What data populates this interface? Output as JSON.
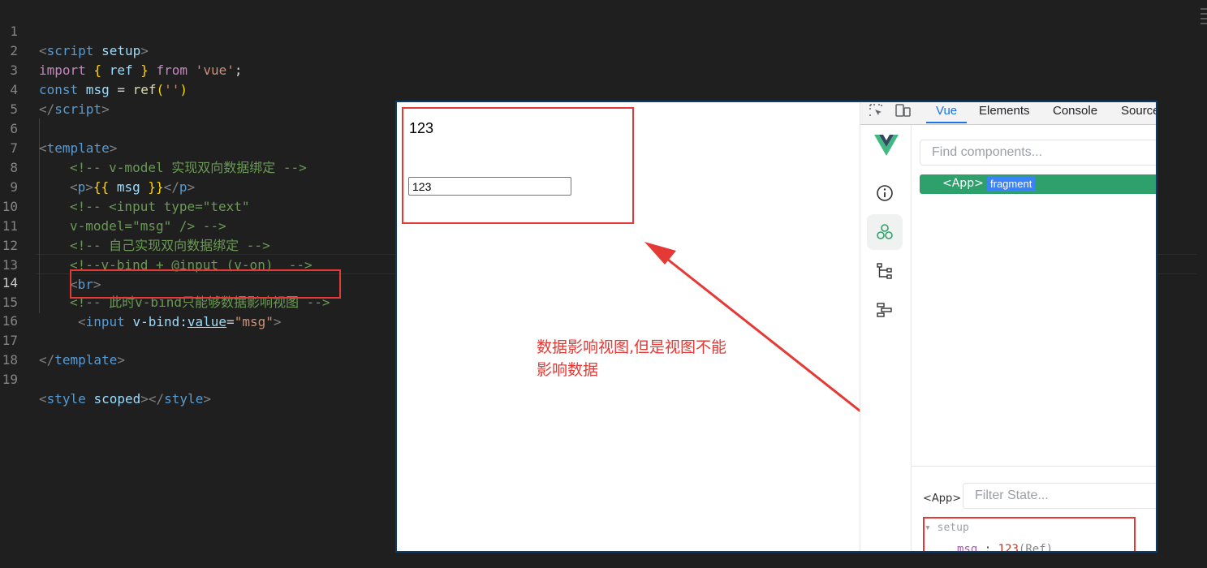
{
  "editor": {
    "lines": [
      {
        "n": "1"
      },
      {
        "n": "2"
      },
      {
        "n": "3"
      },
      {
        "n": "4"
      },
      {
        "n": "5"
      },
      {
        "n": "6"
      },
      {
        "n": "7"
      },
      {
        "n": "8"
      },
      {
        "n": "9"
      },
      {
        "n": "10"
      },
      {
        "n": "11"
      },
      {
        "n": "12"
      },
      {
        "n": "13"
      },
      {
        "n": "14"
      },
      {
        "n": "15"
      },
      {
        "n": "16"
      },
      {
        "n": "17"
      },
      {
        "n": "18"
      },
      {
        "n": "19"
      }
    ],
    "l1": {
      "open": "<",
      "tag": "script",
      "attr": " setup",
      "close": ">"
    },
    "l2": {
      "kw": "import",
      "b1": " { ",
      "var": "ref",
      "b2": " } ",
      "from": "from",
      "str": " 'vue'",
      "semi": ";"
    },
    "l3": {
      "kw": "const",
      "var": " msg",
      "eq": " = ",
      "fn": "ref",
      "p1": "(",
      "str": "''",
      "p2": ")"
    },
    "l4": {
      "open": "</",
      "tag": "script",
      "close": ">"
    },
    "l6": {
      "open": "<",
      "tag": "template",
      "close": ">"
    },
    "l7": {
      "comment": "<!-- v-model 实现双向数据绑定 -->"
    },
    "l8": {
      "open": "<",
      "tag": "p",
      "close": ">",
      "mus1": "{{",
      "var": " msg ",
      "mus2": "}}",
      "open2": "</",
      "tag2": "p",
      "close2": ">"
    },
    "l9": {
      "comment": "<!-- <input type=\"text\""
    },
    "l10": {
      "comment": "v-model=\"msg\" /> -->"
    },
    "l11": {
      "comment": "<!-- 自己实现双向数据绑定 -->"
    },
    "l12": {
      "comment": "<!--v-bind + @input (v-on)  -->"
    },
    "l13": {
      "open": "<",
      "tag": "br",
      "close": ">"
    },
    "l14": {
      "comment": "<!-- 此时v-bind只能够数据影响视图 -->"
    },
    "l15": {
      "open": "<",
      "tag": "input",
      "attr": " v-bind:",
      "attr2": "value",
      "eq": "=",
      "str": "\"msg\"",
      "close": ">"
    },
    "l17": {
      "open": "</",
      "tag": "template",
      "close": ">"
    },
    "l19": {
      "open": "<",
      "tag": "style",
      "attr": " scoped",
      "close": "></",
      "tag2": "style",
      "close2": ">"
    }
  },
  "browser": {
    "page": {
      "paragraph": "123",
      "input_value": "123"
    },
    "annotation": {
      "line1": "数据影响视图,但是视图不能",
      "line2": "影响数据"
    },
    "devtools": {
      "tabs": [
        "Vue",
        "Elements",
        "Console",
        "Source"
      ],
      "active_tab": "Vue",
      "find_placeholder": "Find components...",
      "tree": {
        "tag": "<App>",
        "badge": "fragment"
      },
      "state": {
        "selected": "<App>",
        "filter_placeholder": "Filter State...",
        "section": "setup",
        "entry": {
          "key": "msg",
          "colon": ":",
          "value": "123",
          "type": "(Ref)"
        }
      }
    }
  },
  "colors": {
    "highlight_red": "#e53935",
    "vue_green": "#2ea06b",
    "badge_blue": "#3b82f6",
    "editor_bg": "#1f1f1f"
  }
}
